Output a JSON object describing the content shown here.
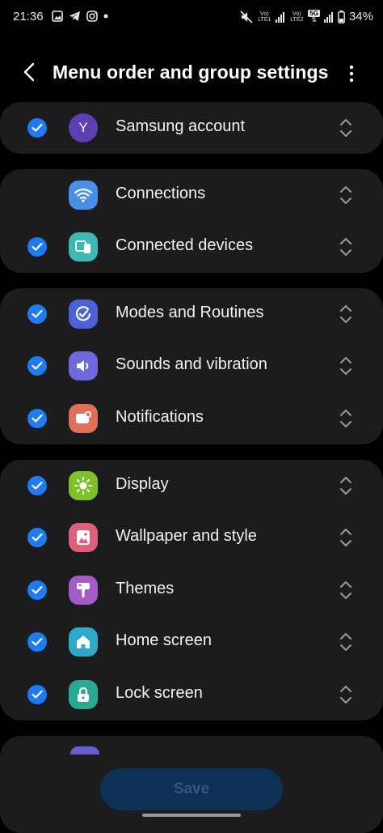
{
  "status_bar": {
    "time": "21:36",
    "battery": "34%",
    "sim1_label": "Vo) LTE1",
    "sim2_label": "Vo) LTE2",
    "network": "5G"
  },
  "header": {
    "title": "Menu order and group settings"
  },
  "groups": [
    {
      "items": [
        {
          "label": "Samsung account",
          "checked": true,
          "icon": "samsung-account-avatar",
          "avatar_letter": "Y",
          "color": "#5b3fb3"
        }
      ]
    },
    {
      "items": [
        {
          "label": "Connections",
          "checked": false,
          "icon": "wifi-icon",
          "color": "#4a8fe6"
        },
        {
          "label": "Connected devices",
          "checked": true,
          "icon": "connected-devices-icon",
          "color": "#3cb9b4"
        }
      ]
    },
    {
      "items": [
        {
          "label": "Modes and Routines",
          "checked": true,
          "icon": "modes-routines-icon",
          "color": "#4d62d6"
        },
        {
          "label": "Sounds and vibration",
          "checked": true,
          "icon": "speaker-icon",
          "color": "#7069dc"
        },
        {
          "label": "Notifications",
          "checked": true,
          "icon": "notifications-icon",
          "color": "#e0705c"
        }
      ]
    },
    {
      "items": [
        {
          "label": "Display",
          "checked": true,
          "icon": "sun-icon",
          "color": "#7ec229"
        },
        {
          "label": "Wallpaper and style",
          "checked": true,
          "icon": "wallpaper-icon",
          "color": "#df5f7b"
        },
        {
          "label": "Themes",
          "checked": true,
          "icon": "themes-brush-icon",
          "color": "#a45ac9"
        },
        {
          "label": "Home screen",
          "checked": true,
          "icon": "home-icon",
          "color": "#2fa9c9"
        },
        {
          "label": "Lock screen",
          "checked": true,
          "icon": "lock-icon",
          "color": "#2aa890"
        }
      ]
    }
  ],
  "footer": {
    "save_label": "Save"
  },
  "colors": {
    "background": "#000000",
    "card": "#1c1c1e",
    "check": "#1f7bef",
    "save_button_bg": "#0d3155",
    "save_button_text": "#34577a"
  }
}
